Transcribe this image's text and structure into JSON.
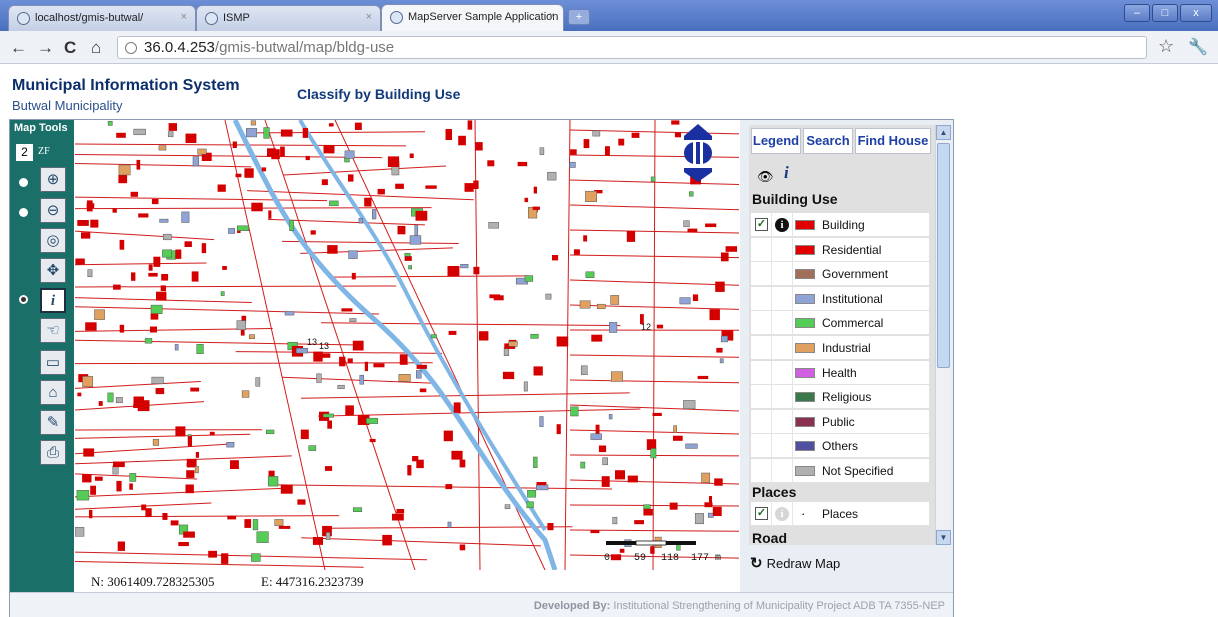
{
  "browser": {
    "tabs": [
      {
        "label": "localhost/gmis-butwal/",
        "active": false
      },
      {
        "label": "ISMP",
        "active": false
      },
      {
        "label": "MapServer Sample Application",
        "active": true
      }
    ],
    "new_tab": "+",
    "url_host": "36.0.4.253",
    "url_path": "/gmis-butwal/map/bldg-use",
    "window_buttons": [
      "–",
      "□",
      "x"
    ]
  },
  "site": {
    "title": "Municipal Information System",
    "subtitle": "Butwal Municipality",
    "page_heading": "Classify by Building Use"
  },
  "map_tools": {
    "label": "Map Tools",
    "zoom_level": "2",
    "zoom_suffix": "ZF",
    "tools": [
      {
        "icon": "zoom-in-icon",
        "glyph": "⊕"
      },
      {
        "icon": "zoom-out-icon",
        "glyph": "⊖"
      },
      {
        "icon": "zoom-extent-icon",
        "glyph": "◎"
      },
      {
        "icon": "pan-icon",
        "glyph": "✥"
      },
      {
        "icon": "info-icon",
        "glyph": "i",
        "selected": true
      },
      {
        "icon": "hand-icon",
        "glyph": "☜"
      },
      {
        "icon": "measure-icon",
        "glyph": "▭"
      },
      {
        "icon": "select-icon",
        "glyph": "⌂"
      },
      {
        "icon": "eraser-icon",
        "glyph": "✎"
      },
      {
        "icon": "print-icon",
        "glyph": "⎙"
      }
    ]
  },
  "map": {
    "labels": [
      "13",
      "13",
      "12"
    ],
    "scalebar": {
      "ticks": [
        "0",
        "59",
        "118",
        "177 m"
      ]
    }
  },
  "coordinates": {
    "north": "N:  3061409.728325305",
    "east": "E:  447316.2323739"
  },
  "legend_panel": {
    "tabs": [
      "Legend",
      "Search",
      "Find House"
    ],
    "building_use_title": "Building Use",
    "items": [
      {
        "label": "Building",
        "color": "#e00000"
      },
      {
        "label": "Residential",
        "color": "#e00000"
      },
      {
        "label": "Government",
        "color": "#a0705a"
      },
      {
        "label": "Institutional",
        "color": "#8fa3d6"
      },
      {
        "label": "Commercal",
        "color": "#55cc55"
      },
      {
        "label": "Industrial",
        "color": "#e0a060"
      },
      {
        "label": "Health",
        "color": "#d060e0"
      },
      {
        "label": "Religious",
        "color": "#3a7a4a"
      },
      {
        "label": "Public",
        "color": "#8a3050"
      },
      {
        "label": "Others",
        "color": "#5050a0"
      },
      {
        "label": "Not Specified",
        "color": "#b0b0b0"
      }
    ],
    "places_title": "Places",
    "places_item": "Places",
    "road_title": "Road",
    "redraw": "Redraw Map"
  },
  "footer": {
    "developed_label": "Developed By:",
    "developed_text": " Institutional Strengthening of Municipality Project ADB TA 7355-NEP"
  }
}
